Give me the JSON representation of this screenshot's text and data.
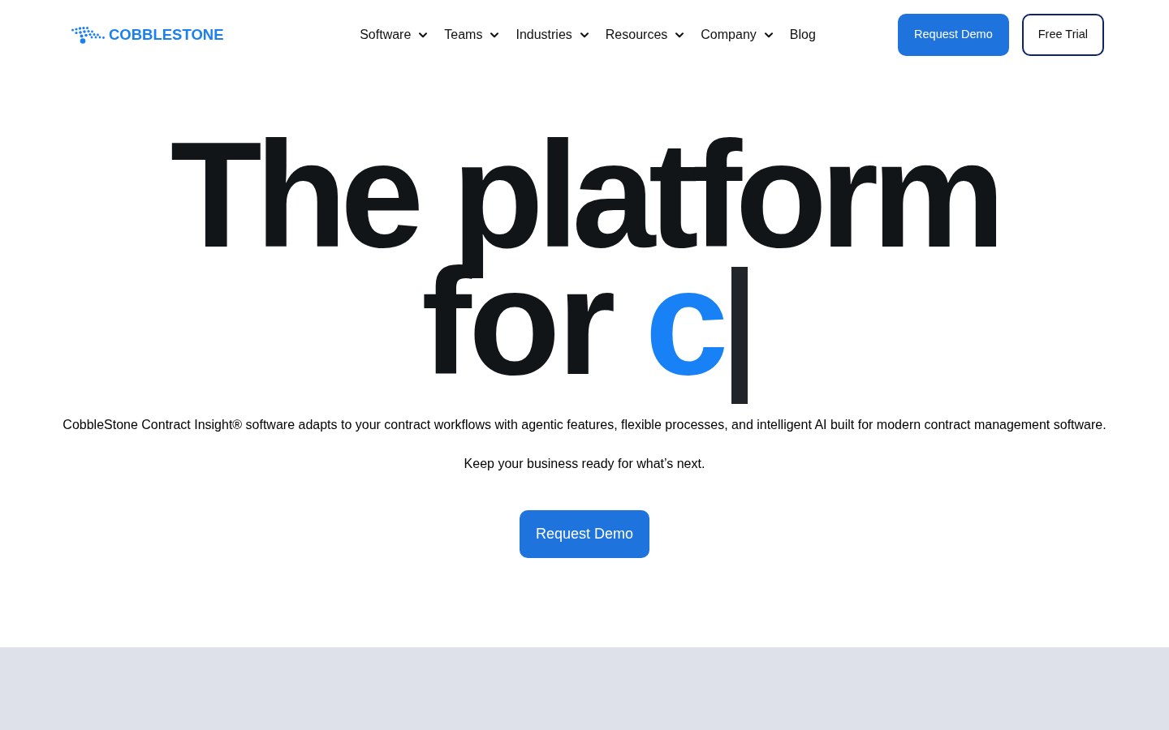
{
  "header": {
    "logo": {
      "text": "COBBLESTONE"
    },
    "nav": [
      {
        "label": "Software",
        "kind": "dropdown"
      },
      {
        "label": "Teams",
        "kind": "dropdown"
      },
      {
        "label": "Industries",
        "kind": "dropdown"
      },
      {
        "label": "Resources",
        "kind": "dropdown"
      },
      {
        "label": "Company",
        "kind": "dropdown"
      },
      {
        "label": "Blog",
        "kind": "link"
      }
    ],
    "buttons": [
      {
        "label": "Request Demo",
        "kind": "primary"
      },
      {
        "label": "Free Trial",
        "kind": "outline"
      }
    ]
  },
  "hero": {
    "headline_line_1": "The platform",
    "headline_line_2": "for",
    "typed_word": "c",
    "description": "CobbleStone Contract Insight® software adapts to your contract workflows with agentic features, flexible processes, and intelligent AI built for modern contract management software.",
    "tagline": "Keep your business ready for what’s next.",
    "cta": "Request Demo"
  }
}
